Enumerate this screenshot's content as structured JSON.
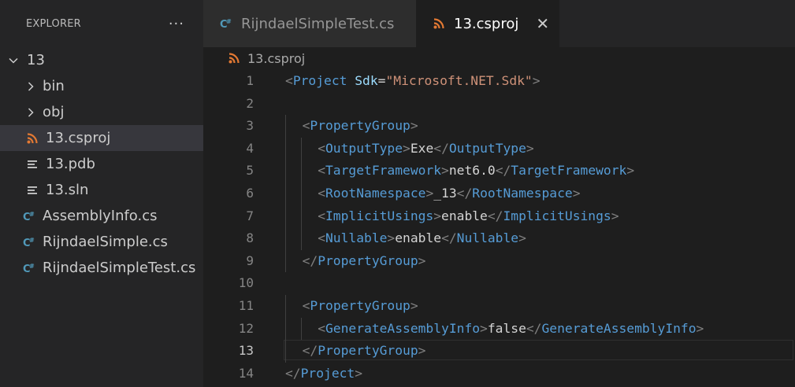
{
  "explorer": {
    "title": "EXPLORER",
    "more": "···",
    "tree": [
      {
        "label": "13",
        "kind": "folder-open",
        "depth": 0
      },
      {
        "label": "bin",
        "kind": "folder",
        "depth": 1
      },
      {
        "label": "obj",
        "kind": "folder",
        "depth": 1
      },
      {
        "label": "13.csproj",
        "kind": "rss-icon",
        "depth": 1,
        "selected": true
      },
      {
        "label": "13.pdb",
        "kind": "lines-icon",
        "depth": 1
      },
      {
        "label": "13.sln",
        "kind": "lines-icon",
        "depth": 1
      },
      {
        "label": "AssemblyInfo.cs",
        "kind": "csharp-icon",
        "depth": 0
      },
      {
        "label": "RijndaelSimple.cs",
        "kind": "csharp-icon",
        "depth": 0
      },
      {
        "label": "RijndaelSimpleTest.cs",
        "kind": "csharp-icon",
        "depth": 0
      }
    ]
  },
  "tabs": [
    {
      "label": "RijndaelSimpleTest.cs",
      "icon": "csharp-icon",
      "active": false
    },
    {
      "label": "13.csproj",
      "icon": "rss-icon",
      "active": true,
      "close": "✕"
    }
  ],
  "breadcrumb": {
    "file": "13.csproj",
    "icon": "rss-icon"
  },
  "colors": {
    "csharp": "#519aba",
    "rss": "#e37933",
    "tag": "#569cd6",
    "attr": "#9cdcfe",
    "string": "#ce9178",
    "bracket": "#808080",
    "text": "#d4d4d4"
  },
  "editor": {
    "active_line": 13,
    "lines": [
      {
        "n": "1",
        "indent": 0,
        "tokens": [
          [
            "br",
            "<"
          ],
          [
            "tag",
            "Project"
          ],
          [
            "txt",
            " "
          ],
          [
            "attr",
            "Sdk"
          ],
          [
            "txt",
            "="
          ],
          [
            "str",
            "\"Microsoft.NET.Sdk\""
          ],
          [
            "br",
            ">"
          ]
        ]
      },
      {
        "n": "2",
        "indent": 0,
        "tokens": []
      },
      {
        "n": "3",
        "indent": 1,
        "tokens": [
          [
            "br",
            "<"
          ],
          [
            "tag",
            "PropertyGroup"
          ],
          [
            "br",
            ">"
          ]
        ]
      },
      {
        "n": "4",
        "indent": 2,
        "tokens": [
          [
            "br",
            "<"
          ],
          [
            "tag",
            "OutputType"
          ],
          [
            "br",
            ">"
          ],
          [
            "txt",
            "Exe"
          ],
          [
            "br",
            "</"
          ],
          [
            "tag",
            "OutputType"
          ],
          [
            "br",
            ">"
          ]
        ]
      },
      {
        "n": "5",
        "indent": 2,
        "tokens": [
          [
            "br",
            "<"
          ],
          [
            "tag",
            "TargetFramework"
          ],
          [
            "br",
            ">"
          ],
          [
            "txt",
            "net6.0"
          ],
          [
            "br",
            "</"
          ],
          [
            "tag",
            "TargetFramework"
          ],
          [
            "br",
            ">"
          ]
        ]
      },
      {
        "n": "6",
        "indent": 2,
        "tokens": [
          [
            "br",
            "<"
          ],
          [
            "tag",
            "RootNamespace"
          ],
          [
            "br",
            ">"
          ],
          [
            "txt",
            "_13"
          ],
          [
            "br",
            "</"
          ],
          [
            "tag",
            "RootNamespace"
          ],
          [
            "br",
            ">"
          ]
        ]
      },
      {
        "n": "7",
        "indent": 2,
        "tokens": [
          [
            "br",
            "<"
          ],
          [
            "tag",
            "ImplicitUsings"
          ],
          [
            "br",
            ">"
          ],
          [
            "txt",
            "enable"
          ],
          [
            "br",
            "</"
          ],
          [
            "tag",
            "ImplicitUsings"
          ],
          [
            "br",
            ">"
          ]
        ]
      },
      {
        "n": "8",
        "indent": 2,
        "tokens": [
          [
            "br",
            "<"
          ],
          [
            "tag",
            "Nullable"
          ],
          [
            "br",
            ">"
          ],
          [
            "txt",
            "enable"
          ],
          [
            "br",
            "</"
          ],
          [
            "tag",
            "Nullable"
          ],
          [
            "br",
            ">"
          ]
        ]
      },
      {
        "n": "9",
        "indent": 1,
        "tokens": [
          [
            "br",
            "</"
          ],
          [
            "tag",
            "PropertyGroup"
          ],
          [
            "br",
            ">"
          ]
        ]
      },
      {
        "n": "10",
        "indent": 0,
        "tokens": []
      },
      {
        "n": "11",
        "indent": 1,
        "tokens": [
          [
            "br",
            "<"
          ],
          [
            "tag",
            "PropertyGroup"
          ],
          [
            "br",
            ">"
          ]
        ]
      },
      {
        "n": "12",
        "indent": 2,
        "tokens": [
          [
            "br",
            "<"
          ],
          [
            "tag",
            "GenerateAssemblyInfo"
          ],
          [
            "br",
            ">"
          ],
          [
            "txt",
            "false"
          ],
          [
            "br",
            "</"
          ],
          [
            "tag",
            "GenerateAssemblyInfo"
          ],
          [
            "br",
            ">"
          ]
        ]
      },
      {
        "n": "13",
        "indent": 1,
        "tokens": [
          [
            "br",
            "</"
          ],
          [
            "tag",
            "PropertyGroup"
          ],
          [
            "br",
            ">"
          ]
        ]
      },
      {
        "n": "14",
        "indent": 0,
        "tokens": [
          [
            "br",
            "</"
          ],
          [
            "tag",
            "Project"
          ],
          [
            "br",
            ">"
          ]
        ]
      }
    ]
  }
}
